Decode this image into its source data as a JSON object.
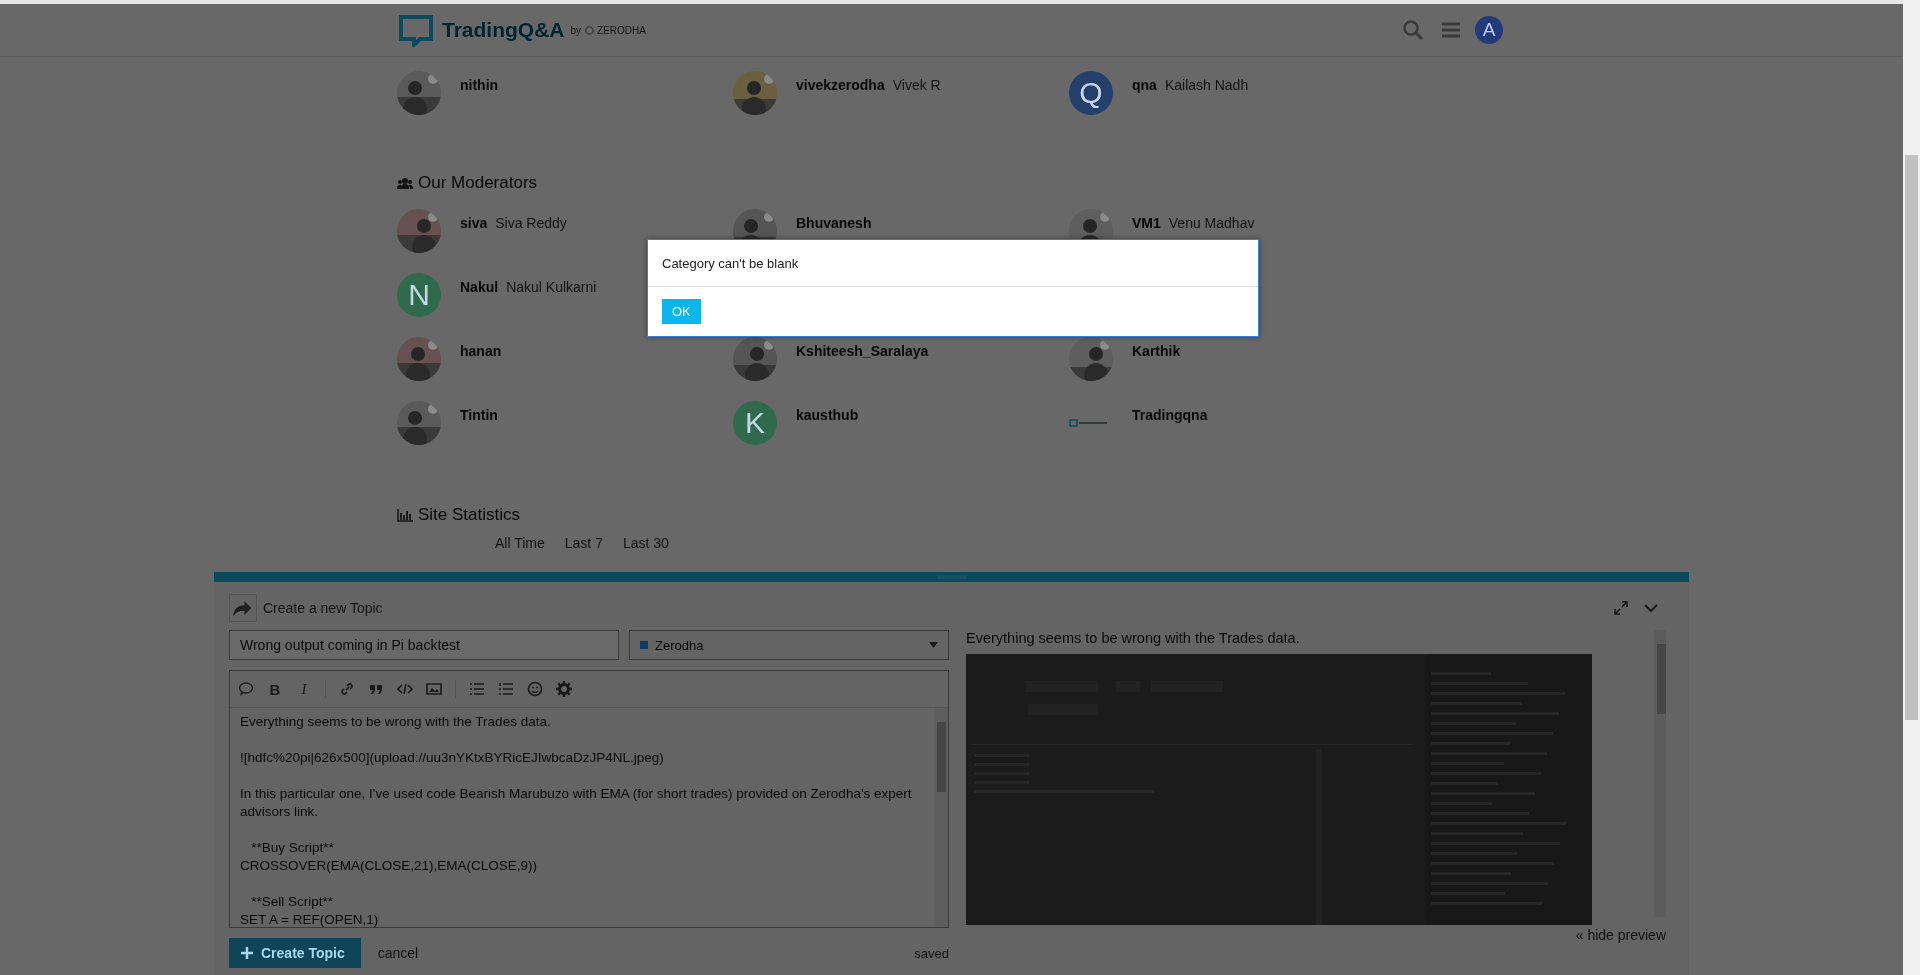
{
  "header": {
    "logo": "TradingQ&A",
    "tagline_by": "by",
    "tagline_brand": "ZERODHA",
    "user_letter": "A"
  },
  "admins": [
    {
      "username": "nithin"
    },
    {
      "username": "vivekzerodha",
      "full_name": "Vivek R"
    },
    {
      "username": "qna",
      "full_name": "Kailash Nadh",
      "avatar": {
        "kind": "letter",
        "letter": "Q",
        "color": "#24406a"
      }
    }
  ],
  "moderators": {
    "heading": "Our Moderators",
    "members": [
      {
        "username": "siva",
        "full_name": "Siva Reddy"
      },
      {
        "username": "Bhuvanesh"
      },
      {
        "username": "VM1",
        "full_name": "Venu Madhav"
      },
      {
        "username": "Nakul",
        "full_name": "Nakul Kulkarni",
        "avatar": {
          "kind": "letter",
          "letter": "N",
          "color": "#2f6a4d"
        }
      },
      {
        "kind": "hidden"
      },
      {
        "kind": "hidden"
      },
      {
        "username": "hanan"
      },
      {
        "username": "Kshiteesh_Saralaya"
      },
      {
        "username": "Karthik"
      },
      {
        "username": "Tintin"
      },
      {
        "username": "kausthub",
        "avatar": {
          "kind": "letter",
          "letter": "K",
          "color": "#2f6a4d"
        }
      },
      {
        "username": "Tradingqna",
        "avatar": {
          "kind": "logo"
        }
      }
    ]
  },
  "statistics": {
    "heading": "Site Statistics",
    "periods": [
      "All Time",
      "Last 7",
      "Last 30"
    ]
  },
  "composer": {
    "action": "Create a new Topic",
    "title_value": "Wrong output coming in Pi backtest",
    "category": {
      "label": "Zerodha",
      "color": "#0d3a66"
    },
    "toolbar": {
      "bold": "B",
      "italic": "I"
    },
    "body": [
      [
        "Everything seems to be wrong with the Trades data."
      ],
      [
        "![hdfc%20pi|626x500](upload://uu3nYKtxBYRicEJIwbcaDzJP4NL.jpeg)"
      ],
      [
        "In this particular one, I've used code Bearish Marubuzo with EMA (for short trades) provided on Zerodha's expert advisors link."
      ],
      [
        "   **Buy Script**",
        "CROSSOVER(EMA(CLOSE,21),EMA(CLOSE,9))"
      ],
      [
        "   **Sell Script**",
        "SET A = REF(OPEN,1)"
      ]
    ],
    "preview_text": "Everything seems to be wrong with the Trades data.",
    "create_button": "Create Topic",
    "cancel": "cancel",
    "status": "saved",
    "hide_preview": "« hide preview"
  },
  "dialog": {
    "message": "Category can't be blank",
    "ok": "OK"
  }
}
